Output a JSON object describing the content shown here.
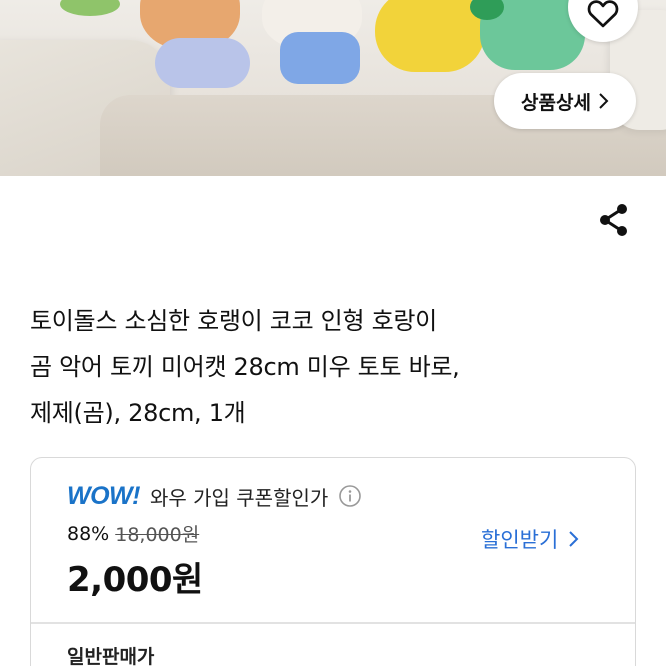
{
  "product_image": {
    "wishlist_icon": "heart-outline-icon",
    "detail_button_label": "상품상세",
    "detail_button_icon": "chevron-right-icon"
  },
  "share_icon": "share-icon",
  "title_lines": [
    "토이돌스 소심한 호랭이 코코 인형 호랑이",
    "곰 악어 토끼 미어캣 28cm 미우 토토 바로,",
    "제제(곰), 28cm, 1개"
  ],
  "price": {
    "wow_logo": "WOW!",
    "wow_label": "와우 가입 쿠폰할인가",
    "info_icon": "info-circle-icon",
    "discount_rate": "88%",
    "original_price": "18,000원",
    "final_price": "2,000원",
    "coupon_link": "할인받기",
    "normal_price_label": "일반판매가"
  },
  "colors": {
    "accent_blue": "#2a6fd6",
    "wow_blue": "#1a73c8"
  }
}
